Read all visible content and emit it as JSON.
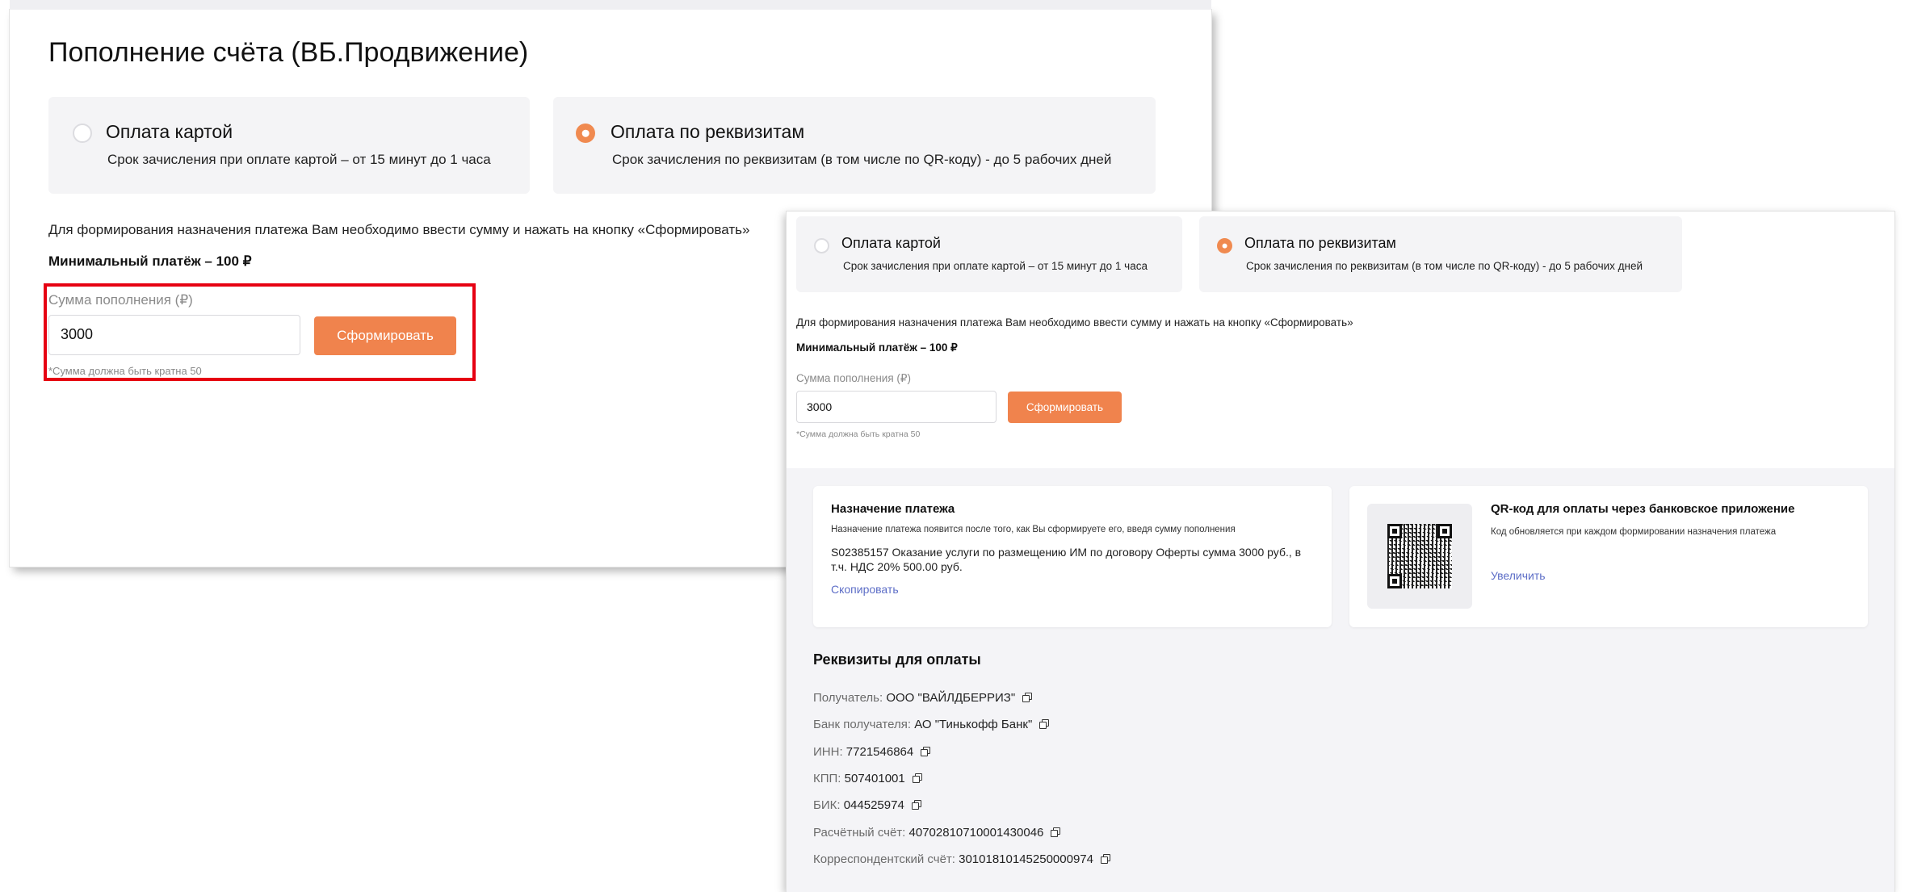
{
  "back": {
    "title": "Пополнение счёта (ВБ.Продвижение)",
    "options": [
      {
        "title": "Оплата картой",
        "desc": "Срок зачисления при оплате картой – от 15 минут до 1 часа",
        "selected": false
      },
      {
        "title": "Оплата по реквизитам",
        "desc": "Срок зачисления по реквизитам (в том числе по QR-коду) - до 5 рабочих дней",
        "selected": true
      }
    ],
    "instruction": "Для формирования назначения платежа Вам необходимо ввести сумму и нажать на кнопку «Сформировать»",
    "min_payment": "Минимальный платёж – 100 ₽",
    "amount_label": "Сумма пополнения (₽)",
    "amount_value": "3000",
    "generate_label": "Сформировать",
    "hint": "*Сумма должна быть кратна 50"
  },
  "front": {
    "options": [
      {
        "title": "Оплата картой",
        "desc": "Срок зачисления при оплате картой – от 15 минут до 1 часа",
        "selected": false
      },
      {
        "title": "Оплата по реквизитам",
        "desc": "Срок зачисления по реквизитам (в том числе по QR-коду) - до 5 рабочих дней",
        "selected": true
      }
    ],
    "instruction": "Для формирования назначения платежа Вам необходимо ввести сумму и нажать на кнопку «Сформировать»",
    "min_payment": "Минимальный платёж – 100 ₽",
    "amount_label": "Сумма пополнения (₽)",
    "amount_value": "3000",
    "generate_label": "Сформировать",
    "hint": "*Сумма должна быть кратна 50",
    "purpose": {
      "title": "Назначение платежа",
      "subtitle": "Назначение платежа появится после того, как Вы сформируете его, введя сумму пополнения",
      "text": "S02385157 Оказание услуги по размещению ИМ по договору Оферты сумма 3000 руб., в т.ч. НДС 20% 500.00 руб.",
      "copy_label": "Скопировать"
    },
    "qr": {
      "title": "QR-код для оплаты через банковское приложение",
      "subtitle": "Код обновляется при каждом формировании назначения платежа",
      "enlarge_label": "Увеличить"
    },
    "requisites": {
      "title": "Реквизиты для оплаты",
      "rows": [
        {
          "label": "Получатель:",
          "value": "ООО \"ВАЙЛДБЕРРИЗ\""
        },
        {
          "label": "Банк получателя:",
          "value": "АО \"Тинькофф Банк\""
        },
        {
          "label": "ИНН:",
          "value": "7721546864"
        },
        {
          "label": "КПП:",
          "value": "507401001"
        },
        {
          "label": "БИК:",
          "value": "044525974"
        },
        {
          "label": "Расчётный счёт:",
          "value": "40702810710001430046"
        },
        {
          "label": "Корреспондентский счёт:",
          "value": "30101810145250000974"
        }
      ]
    }
  },
  "colors": {
    "accent": "#f0834d",
    "highlight": "#e60012",
    "link": "#5d6ec7"
  },
  "icons": [
    "radio-unchecked-icon",
    "radio-checked-icon",
    "copy-icon",
    "qr-code-icon"
  ]
}
